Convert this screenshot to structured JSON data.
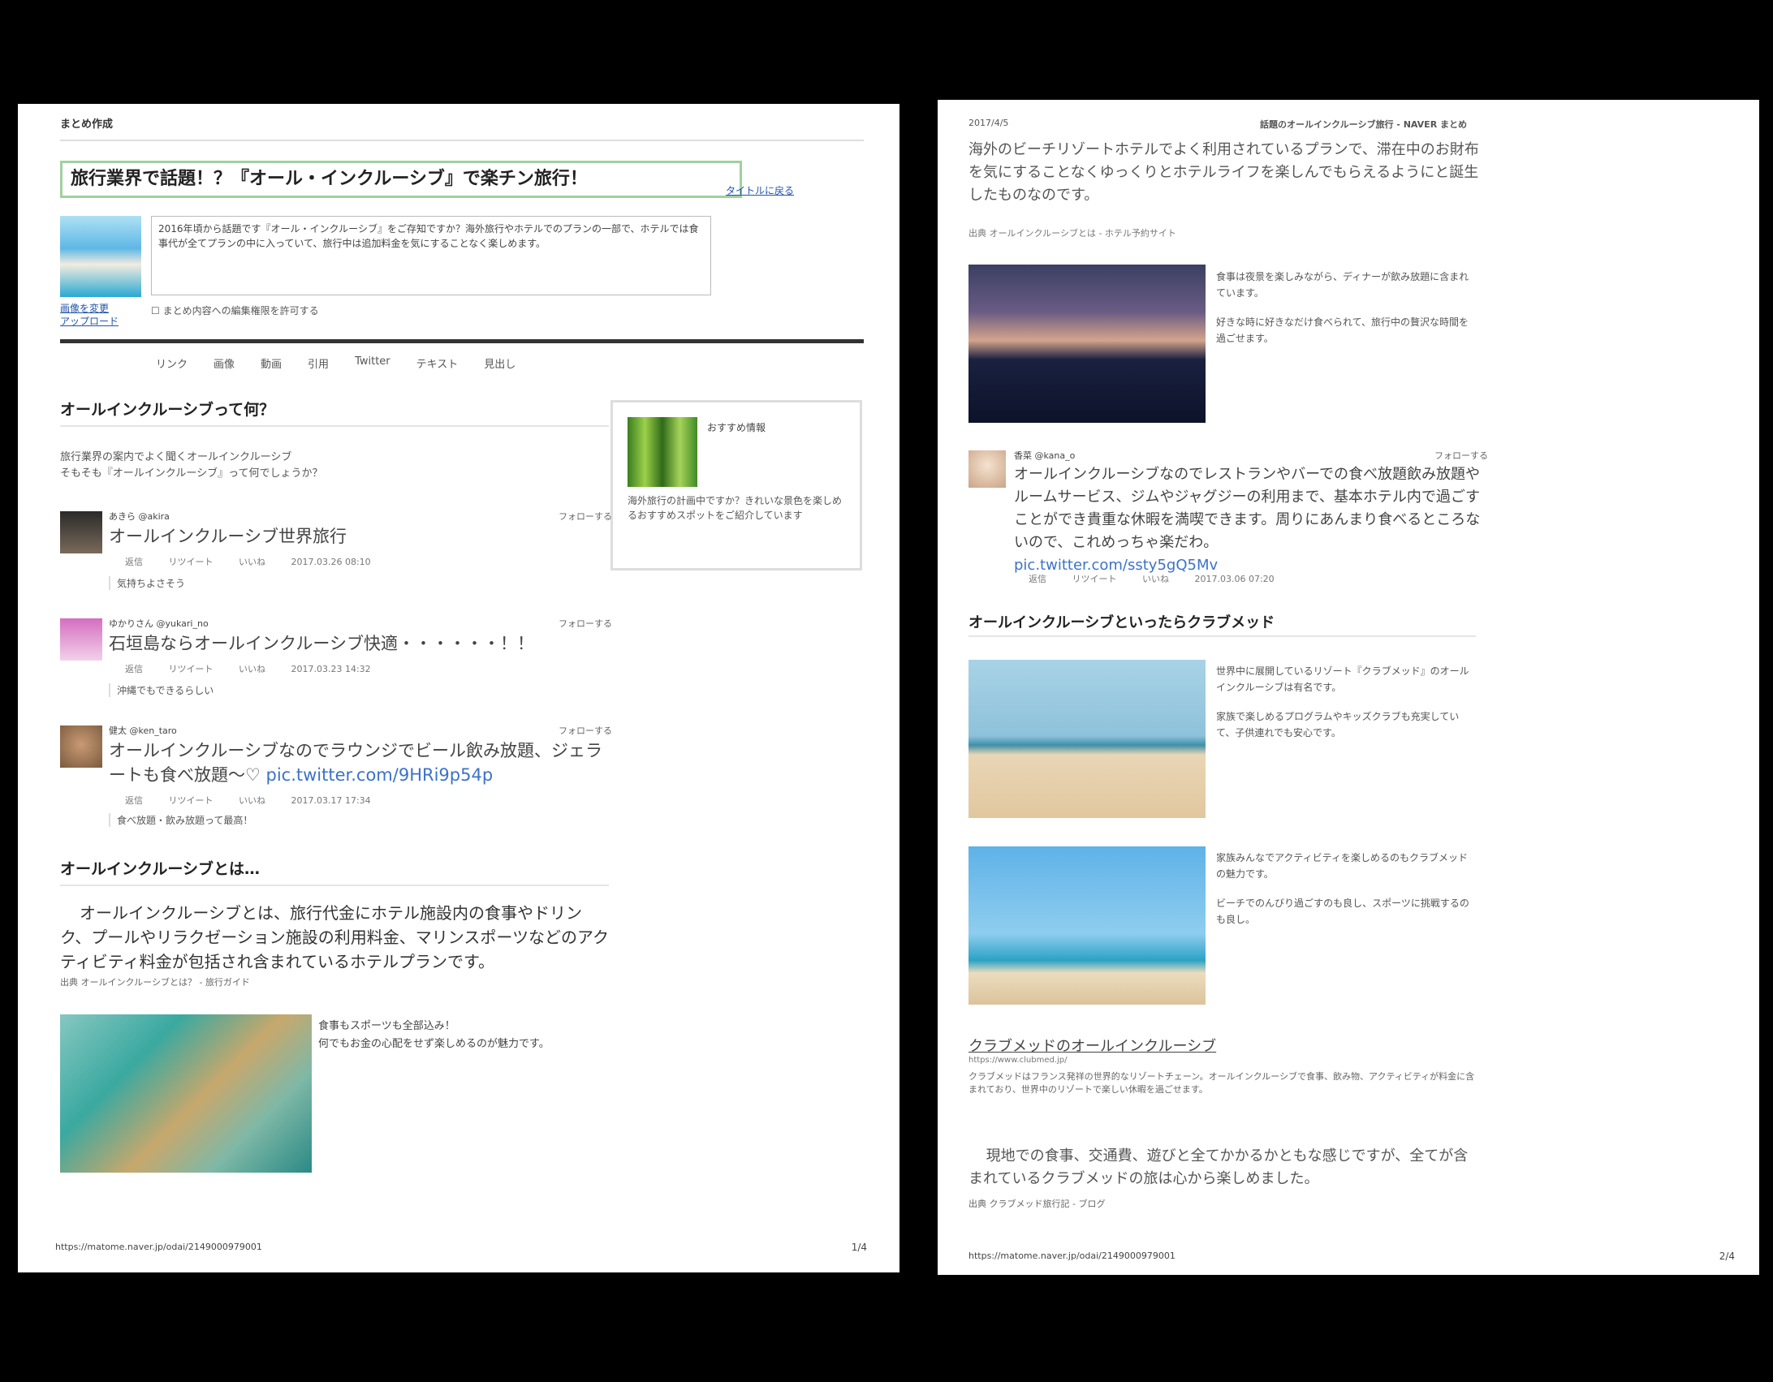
{
  "page1": {
    "header": "まとめ作成",
    "title": "旅行業界で話題！？『オール・インクルーシブ』で楽チン旅行！",
    "title_side_link": "タイトルに戻る",
    "thumb_label_1": "画像を変更",
    "thumb_label_2": "アップロード",
    "description": "2016年頃から話題です『オール・インクルーシブ』をご存知ですか？海外旅行やホテルでのプランの一部で、ホテルでは食事代が全てプランの中に入っていて、旅行中は追加料金を気にすることなく楽しめます。",
    "checkbox_label": "まとめ内容への編集権限を許可する",
    "nav": [
      "リンク",
      "画像",
      "動画",
      "引用",
      "Twitter",
      "テキスト",
      "見出し"
    ],
    "section1_heading": "オールインクルーシブって何？",
    "section1_intro_1": "旅行業界の案内でよく聞くオールインクルーシブ",
    "section1_intro_2": "そもそも『オールインクルーシブ』って何でしょうか？",
    "ad": {
      "title": "おすすめ情報",
      "text": "海外旅行の計画中ですか？きれいな景色を楽しめるおすすめスポットをご紹介しています"
    },
    "tweets": [
      {
        "name": "あきら @akira",
        "follow": "フォローする",
        "body": "オールインクルーシブ世界旅行",
        "meta": [
          "返信",
          "リツイート",
          "いいね",
          "2017.03.26 08:10"
        ],
        "comment": "気持ちよさそう"
      },
      {
        "name": "ゆかりさん @yukari_no",
        "follow": "フォローする",
        "body": "石垣島ならオールインクルーシブ快適・・・・・・！！",
        "meta": [
          "返信",
          "リツイート",
          "いいね",
          "2017.03.23 14:32"
        ],
        "comment": "沖縄でもできるらしい"
      },
      {
        "name": "健太 @ken_taro",
        "follow": "フォローする",
        "body": "オールインクルーシブなのでラウンジでビール飲み放題、ジェラートも食べ放題〜♡",
        "link": "pic.twitter.com/9HRi9p54p",
        "meta": [
          "返信",
          "リツイート",
          "いいね",
          "2017.03.17 17:34"
        ],
        "comment": "食べ放題・飲み放題って最高！"
      }
    ],
    "section2_heading": "オールインクルーシブとは…",
    "section2_body": "オールインクルーシブとは、旅行代金にホテル施設内の食事やドリンク、プールやリラクゼーション施設の利用料金、マリンスポーツなどのアクティビティ料金が包括され含まれているホテルプランです。",
    "section2_cite": "出典 オールインクルーシブとは？ - 旅行ガイド",
    "kayak_text_1": "食事もスポーツも全部込み！",
    "kayak_text_2": "何でもお金の心配をせず楽しめるのが魅力です。",
    "footer_url": "https://matome.naver.jp/odai/2149000979001",
    "footer_page": "1/4"
  },
  "page2": {
    "header_left": "2017/4/5",
    "header_right": "話題のオールインクルーシブ旅行 - NAVER まとめ",
    "intro": "海外のビーチリゾートホテルでよく利用されているプランで、滞在中のお財布を気にすることなくゆっくりとホテルライフを楽しんでもらえるようにと誕生したものなのです。",
    "intro_cite": "出典 オールインクルーシブとは - ホテル予約サイト",
    "night_text_1": "食事は夜景を楽しみながら、ディナーが飲み放題に含まれています。",
    "night_text_2": "好きな時に好きなだけ食べられて、旅行中の贅沢な時間を過ごせます。",
    "tweet": {
      "name": "香菜 @kana_o",
      "follow": "フォローする",
      "body": "オールインクルーシブなのでレストランやバーでの食べ放題飲み放題やルームサービス、ジムやジャグジーの利用まで、基本ホテル内で過ごすことができ貴重な休暇を満喫できます。周りにあんまり食べるところないので、これめっちゃ楽だわ。",
      "link": "pic.twitter.com/ssty5gQ5Mv",
      "meta": [
        "返信",
        "リツイート",
        "いいね",
        "2017.03.06 07:20"
      ]
    },
    "section_heading": "オールインクルーシブといったらクラブメッド",
    "beach_text_1": "世界中に展開しているリゾート『クラブメッド』のオールインクルーシブは有名です。",
    "beach_text_2": "家族で楽しめるプログラムやキッズクラブも充実していて、子供連れでも安心です。",
    "family_text_1": "家族みんなでアクティビティを楽しめるのもクラブメッドの魅力です。",
    "family_text_2": "ビーチでのんびり過ごすのも良し、スポーツに挑戦するのも良し。",
    "link_heading": "クラブメッドのオールインクルーシブ",
    "link_url": "https://www.clubmed.jp/",
    "link_desc": "クラブメッドはフランス発祥の世界的なリゾートチェーン。オールインクルーシブで食事、飲み物、アクティビティが料金に含まれており、世界中のリゾートで楽しい休暇を過ごせます。",
    "closing": "現地での食事、交通費、遊びと全てかかるかともな感じですが、全てが含まれているクラブメッドの旅は心から楽しめました。",
    "closing_cite": "出典 クラブメッド旅行記 - ブログ",
    "footer_url": "https://matome.naver.jp/odai/2149000979001",
    "footer_page": "2/4"
  }
}
